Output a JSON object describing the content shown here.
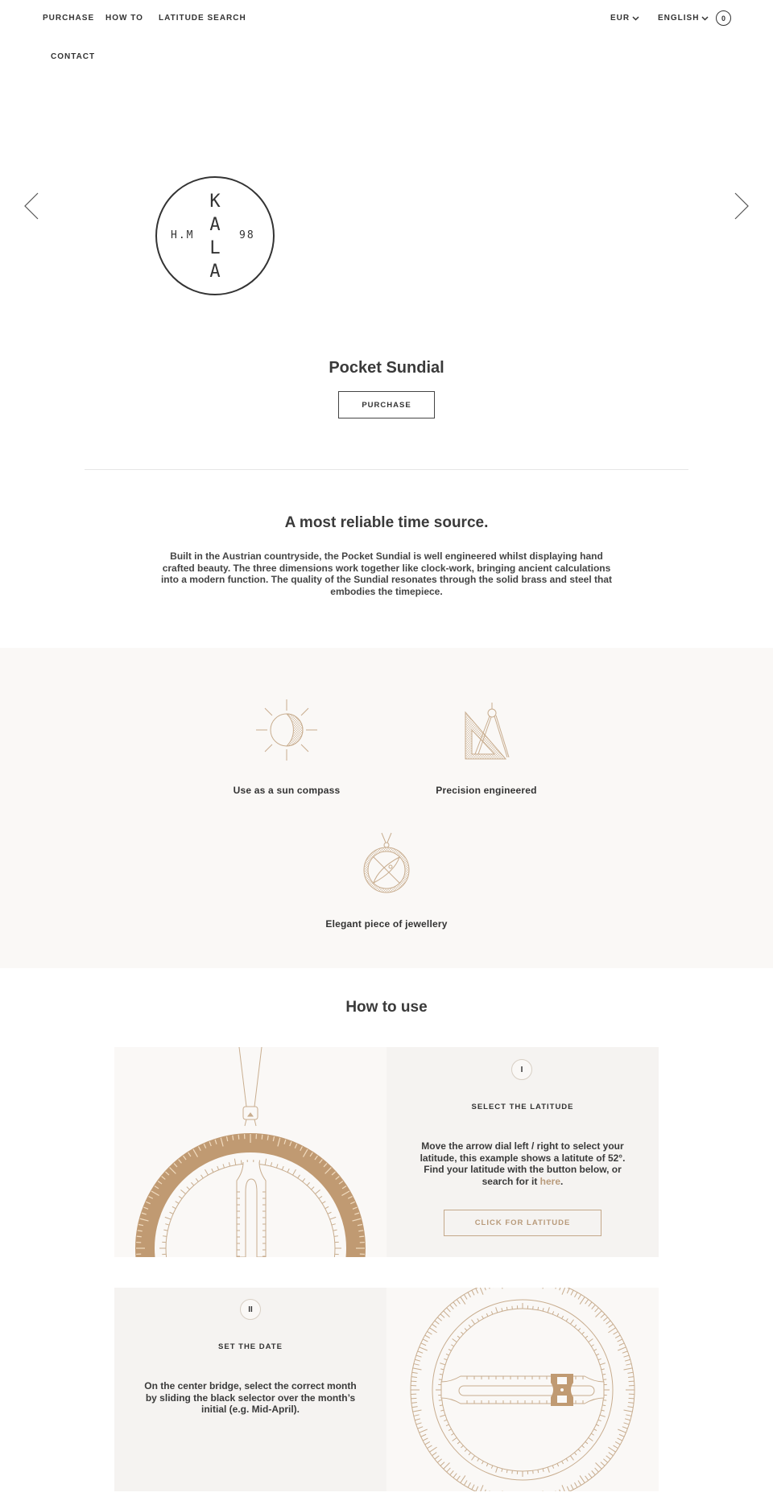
{
  "header": {
    "nav": [
      {
        "label": "PURCHASE"
      },
      {
        "label": "HOW TO"
      },
      {
        "label": "LATITUDE SEARCH"
      },
      {
        "label": "CONTACT"
      }
    ],
    "currency": "EUR",
    "language": "ENGLISH",
    "cart_count": "0"
  },
  "hero": {
    "logo": {
      "top": "K",
      "l2": "A",
      "l3": "L",
      "bottom": "A",
      "left": "H.M",
      "right": "98"
    },
    "title": "Pocket Sundial",
    "purchase_label": "PURCHASE"
  },
  "intro": {
    "title": "A most reliable time source.",
    "body": "Built in the Austrian countryside, the Pocket Sundial is well engineered whilst displaying hand crafted beauty. The three dimensions work together like clock-work, bringing ancient calculations into a modern function. The quality of the Sundial resonates through the solid brass and steel that embodies the timepiece."
  },
  "features": [
    {
      "icon": "sun-icon",
      "label": "Use as a sun compass"
    },
    {
      "icon": "compass-set-square-icon",
      "label": "Precision engineered"
    },
    {
      "icon": "pendant-icon",
      "label": "Elegant piece of jewellery"
    }
  ],
  "howto": {
    "title": "How to use",
    "steps": [
      {
        "number": "I",
        "title": "SELECT THE LATITUDE",
        "text_before": "Move the arrow dial left / right to select your latitude, this example shows a latitute of 52°. Find your latitude with the button below, or search for it ",
        "link": "here",
        "text_after": ".",
        "button": "CLICK FOR LATITUDE"
      },
      {
        "number": "II",
        "title": "SET THE DATE",
        "text": "On the center bridge, select the correct month by sliding the black selector over the month’s initial (e.g. Mid-April)."
      }
    ]
  },
  "colors": {
    "brass": "#c09a72",
    "line": "#c8ad8f",
    "panel_light": "#faf8f6",
    "panel_dark": "#f5f3f1",
    "text": "#333333",
    "link": "#b89a7a"
  }
}
